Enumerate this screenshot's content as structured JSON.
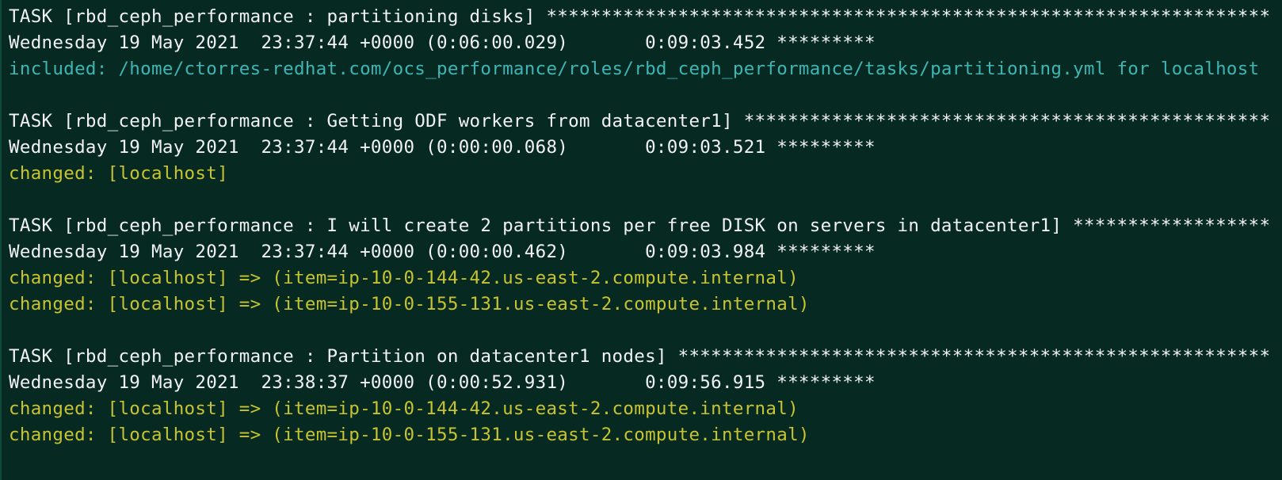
{
  "colors": {
    "background": "#062a22",
    "default_text": "#f2f2f2",
    "included": "#3fb5b6",
    "changed": "#c8c331"
  },
  "terminal": {
    "lines": [
      "TASK [rbd_ceph_performance : partitioning disks] ******************************************************************",
      "Wednesday 19 May 2021  23:37:44 +0000 (0:06:00.029)       0:09:03.452 *********",
      "included: /home/ctorres-redhat.com/ocs_performance/roles/rbd_ceph_performance/tasks/partitioning.yml for localhost",
      "",
      "TASK [rbd_ceph_performance : Getting ODF workers from datacenter1] ************************************************",
      "Wednesday 19 May 2021  23:37:44 +0000 (0:00:00.068)       0:09:03.521 *********",
      "changed: [localhost]",
      "",
      "TASK [rbd_ceph_performance : I will create 2 partitions per free DISK on servers in datacenter1] ******************",
      "Wednesday 19 May 2021  23:37:44 +0000 (0:00:00.462)       0:09:03.984 *********",
      "changed: [localhost] => (item=ip-10-0-144-42.us-east-2.compute.internal)",
      "changed: [localhost] => (item=ip-10-0-155-131.us-east-2.compute.internal)",
      "",
      "TASK [rbd_ceph_performance : Partition on datacenter1 nodes] ******************************************************",
      "Wednesday 19 May 2021  23:38:37 +0000 (0:00:52.931)       0:09:56.915 *********",
      "changed: [localhost] => (item=ip-10-0-144-42.us-east-2.compute.internal)",
      "changed: [localhost] => (item=ip-10-0-155-131.us-east-2.compute.internal)"
    ]
  }
}
